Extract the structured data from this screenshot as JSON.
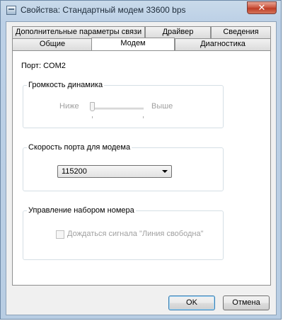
{
  "window": {
    "title": "Свойства: Стандартный модем 33600 bps",
    "close_glyph": "✕"
  },
  "tabs": {
    "row_back": [
      {
        "label": "Дополнительные параметры связи"
      },
      {
        "label": "Драйвер"
      },
      {
        "label": "Сведения"
      }
    ],
    "row_front": [
      {
        "label": "Общие"
      },
      {
        "label": "Модем",
        "active": true
      },
      {
        "label": "Диагностика"
      }
    ]
  },
  "modem": {
    "port_label": "Порт:",
    "port_value": "COM2",
    "volume": {
      "group_label": "Громкость динамика",
      "low_label": "Ниже",
      "high_label": "Выше",
      "level_fraction": 0.0,
      "enabled": false
    },
    "speed": {
      "group_label": "Скорость порта для модема",
      "selected": "115200"
    },
    "dialing": {
      "group_label": "Управление набором номера",
      "wait_dialtone_label": "Дождаться сигнала \"Линия свободна\"",
      "wait_dialtone_checked": false,
      "enabled": false
    }
  },
  "buttons": {
    "ok": "OK",
    "cancel": "Отмена"
  }
}
